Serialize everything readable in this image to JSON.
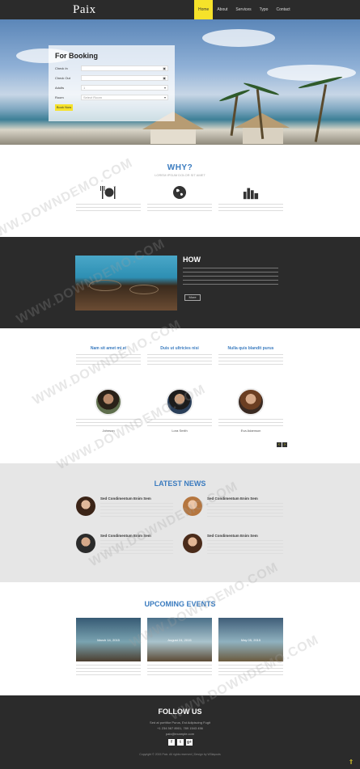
{
  "header": {
    "logo": "Paix",
    "nav": [
      "Home",
      "About",
      "Services",
      "Typo",
      "Contact"
    ]
  },
  "booking": {
    "title": "For Booking",
    "fields": [
      {
        "label": "Check In",
        "value": "",
        "icon": "calendar-icon"
      },
      {
        "label": "Check Out",
        "value": "",
        "icon": "calendar-icon"
      },
      {
        "label": "Adults",
        "value": "1",
        "icon": "chevron-down-icon"
      },
      {
        "label": "Room",
        "value": "Select Room",
        "icon": "chevron-down-icon"
      }
    ],
    "button": "Book Now"
  },
  "why": {
    "title": "WHY?",
    "subtitle": "LOREM IPSUM DOLOR SIT AMET",
    "items": [
      {
        "icon": "restaurant-icon"
      },
      {
        "icon": "globe-icon"
      },
      {
        "icon": "city-icon"
      }
    ]
  },
  "how": {
    "title": "HOW",
    "button": "More"
  },
  "columns": [
    {
      "title": "Nam sit amet mi et"
    },
    {
      "title": "Duis ut ultricies nisi"
    },
    {
      "title": "Nulla quis blandit purus"
    }
  ],
  "people": [
    {
      "name": "Johnson"
    },
    {
      "name": "Lora Smith"
    },
    {
      "name": "Eva Adamson"
    }
  ],
  "news": {
    "title": "LATEST NEWS",
    "items": [
      {
        "title": "Sed Condimentum Enim Sem"
      },
      {
        "title": "Sed Condimentum Enim Sem"
      },
      {
        "title": "Sed Condimentum Enim Sem"
      },
      {
        "title": "Sed Condimentum Enim Sem"
      }
    ]
  },
  "events": {
    "title": "UPCOMING EVENTS",
    "dates": [
      "March 14, 2015",
      "August 24, 2015",
      "May 05, 2015"
    ]
  },
  "footer": {
    "title": "FOLLOW US",
    "address": "Sed at porttitor Purus, Est Adipiscing Fugit",
    "phone": "+1 234 567 8901, 789 1543 456",
    "email": "paix@example.com",
    "social": [
      "f",
      "t",
      "g+"
    ],
    "copyright": "Copyright © 2015 Paix. All rights reserved | Design by W3layouts"
  },
  "watermark": "WWW.DOWNDEMO.COM",
  "colors": {
    "accent": "#3a7bbf",
    "nav_active": "#f6e22a",
    "dark": "#2b2b2b"
  }
}
